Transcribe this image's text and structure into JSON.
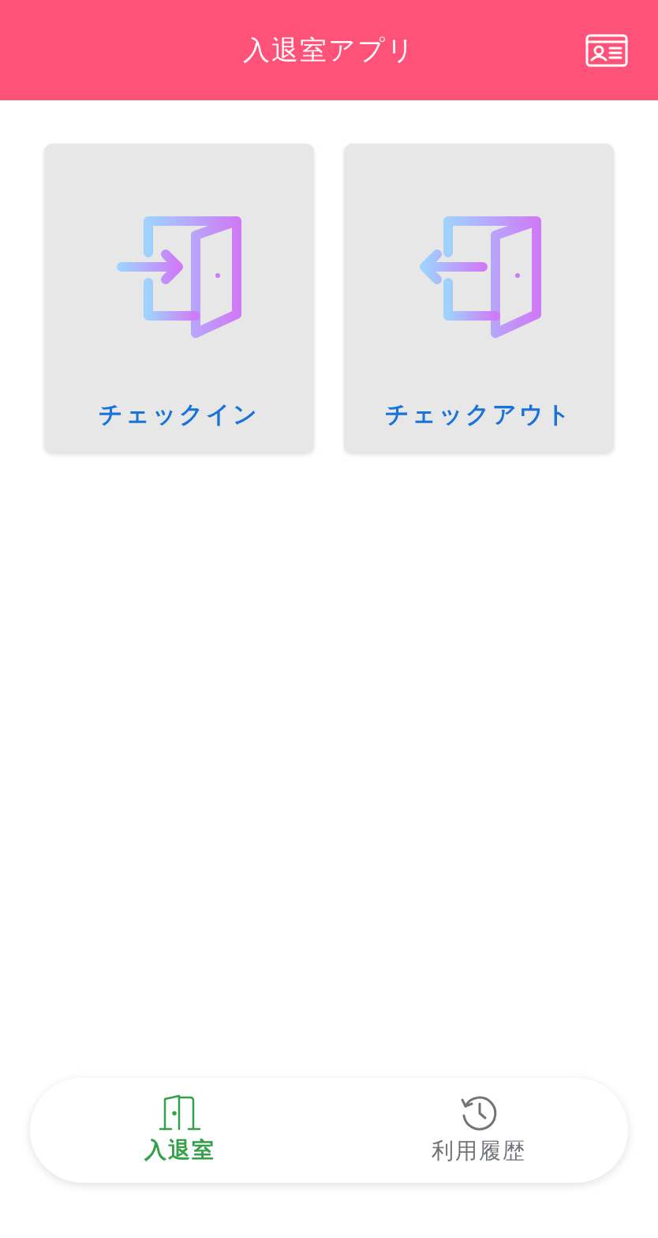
{
  "header": {
    "title": "入退室アプリ"
  },
  "tiles": [
    {
      "label": "チェックイン",
      "kind": "in"
    },
    {
      "label": "チェックアウト",
      "kind": "out"
    }
  ],
  "tabs": [
    {
      "label": "入退室",
      "kind": "door",
      "selected": true
    },
    {
      "label": "利用履歴",
      "kind": "history",
      "selected": false
    }
  ]
}
